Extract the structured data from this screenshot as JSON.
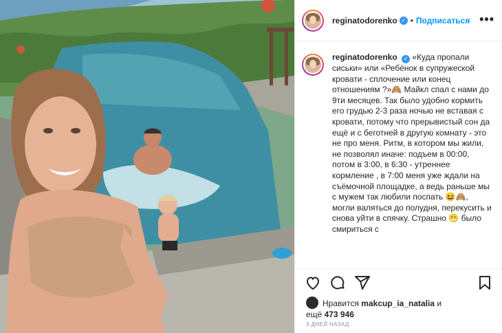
{
  "header": {
    "username": "reginatodorenko",
    "separator": "•",
    "follow_label": "Подписаться",
    "more_label": "•••"
  },
  "caption": {
    "username": "reginatodorenko",
    "text": "«Куда пропали сиськи» или «Ребёнок в супружеской кровати - сплочение или конец отношениям ?»🙈 Майкл спал с нами до 9ти месяцев. Так было удобно кормить его грудью 2-3 раза ночью не вставая с кровати, потому что прерывистый сон да ещё и с беготней в другую комнату - это не про меня. Ритм, в котором мы жили, не позволял иначе: подъем в 00:00, потом в 3:00, в 6:30 - утреннее кормление , в 7:00 меня уже ждали на съёмочной площадке, а ведь раньше мы с мужем так любили поспать 😆🙈, могли валяться до полудня, перекусить и снова уйти в спячку. Страшно 😬 было смириться с"
  },
  "actions": {
    "like_icon": "heart-icon",
    "comment_icon": "comment-icon",
    "share_icon": "share-icon",
    "save_icon": "bookmark-icon"
  },
  "likes": {
    "prefix": "Нравится",
    "liker": "makcup_ia_natalia",
    "connector": "и",
    "count_prefix": "ещё",
    "count": "473 946"
  },
  "time_ago": "3 дней назад",
  "colors": {
    "accent": "#0095f6",
    "verified": "#3897f0",
    "border": "#efefef",
    "muted": "#8e8e8e"
  }
}
